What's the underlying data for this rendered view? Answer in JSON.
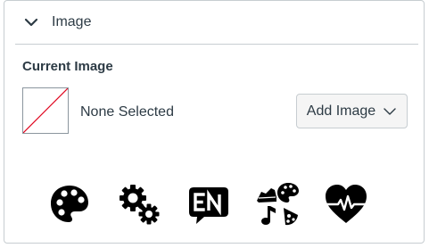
{
  "panel": {
    "title": "Image",
    "toggle_icon": "chevron-down-icon"
  },
  "current_image": {
    "label": "Current Image",
    "status": "None Selected",
    "preview_icon": "empty-image-placeholder"
  },
  "add_image": {
    "label": "Add Image",
    "icon": "chevron-down-icon"
  },
  "icon_options": [
    {
      "name": "palette-icon"
    },
    {
      "name": "gears-icon"
    },
    {
      "name": "language-en-icon"
    },
    {
      "name": "electives-icon"
    },
    {
      "name": "heartbeat-icon"
    }
  ],
  "colors": {
    "text": "#2d3b45",
    "border": "#c7cdd1",
    "placeholder_slash": "#e0061f",
    "button_bg": "#f5f5f5",
    "icon": "#000000"
  }
}
